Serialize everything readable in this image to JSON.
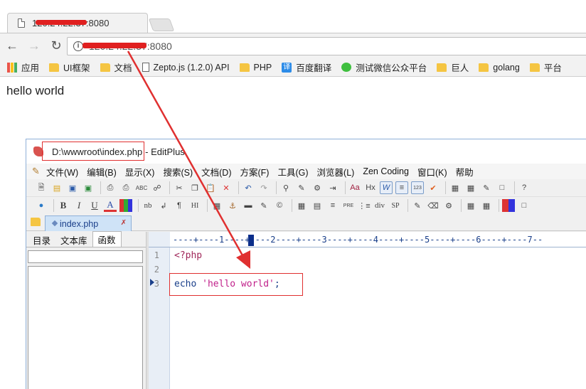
{
  "browser": {
    "tab_title": "120.24.22.37:8080",
    "url": "120.24.22.37:8080",
    "bookmarks": [
      {
        "label": "应用",
        "icon": "apps-icon"
      },
      {
        "label": "UI框架",
        "icon": "folder-icon"
      },
      {
        "label": "文档",
        "icon": "folder-icon"
      },
      {
        "label": "Zepto.js (1.2.0) API",
        "icon": "page-icon"
      },
      {
        "label": "PHP",
        "icon": "folder-icon"
      },
      {
        "label": "百度翻译",
        "icon": "translate-icon"
      },
      {
        "label": "测试微信公众平台",
        "icon": "wechat-icon"
      },
      {
        "label": "巨人",
        "icon": "folder-icon"
      },
      {
        "label": "golang",
        "icon": "folder-icon"
      },
      {
        "label": "平台",
        "icon": "folder-icon"
      }
    ]
  },
  "page": {
    "text": "hello world"
  },
  "editplus": {
    "title_path": "D:\\wwwroot\\index.php",
    "title_suffix": " - EditPlus",
    "menu": [
      "文件(W)",
      "编辑(B)",
      "显示(X)",
      "搜索(S)",
      "文档(D)",
      "方案(F)",
      "工具(G)",
      "浏览器(L)",
      "Zen Coding",
      "窗口(K)",
      "帮助"
    ],
    "toolbar2_labels": {
      "b": "B",
      "i": "I",
      "u": "U",
      "a": "A",
      "nb": "nb",
      "hi": "HI",
      "pre": "PRE",
      "div": "div",
      "sp": "SP",
      "para": "¶"
    },
    "file_tab": "index.php",
    "side_tabs": [
      "目录",
      "文本库",
      "函数"
    ],
    "ruler": "----+----1----+----2----+----3----+----4----+----5----+----6----+----7--",
    "lines": [
      {
        "num": "1",
        "tokens": [
          {
            "t": "<?php",
            "c": "php"
          }
        ]
      },
      {
        "num": "2",
        "tokens": []
      },
      {
        "num": "3",
        "tokens": [
          {
            "t": "echo ",
            "c": "kw"
          },
          {
            "t": "'hello world'",
            "c": "str"
          },
          {
            "t": ";",
            "c": "kw"
          }
        ]
      }
    ]
  },
  "colors": {
    "annotation": "#e03030",
    "redaction": "#e02020"
  }
}
